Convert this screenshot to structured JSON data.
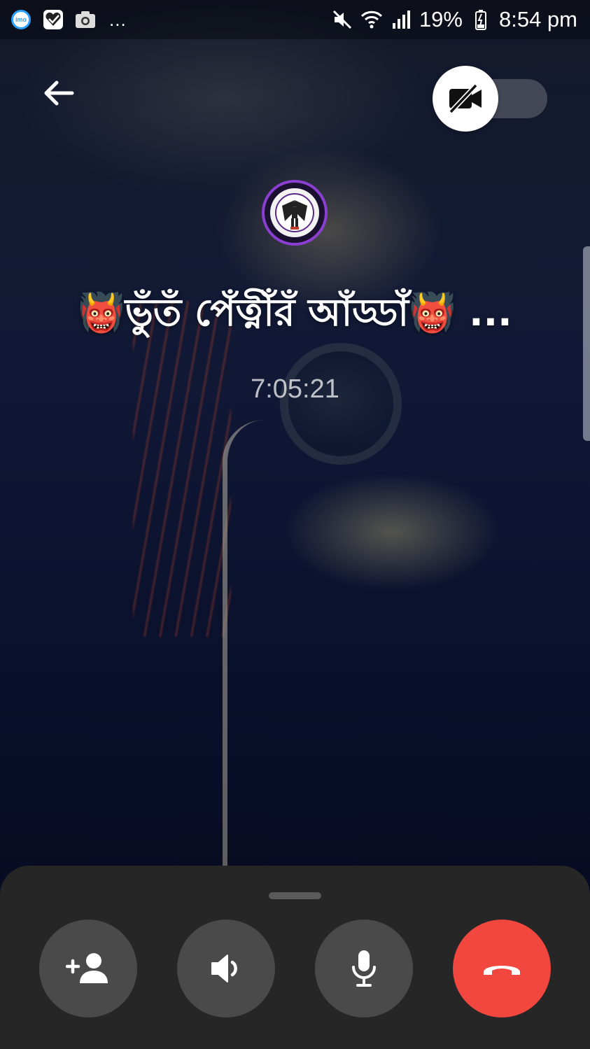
{
  "status_bar": {
    "battery": "19%",
    "time": "8:54 pm",
    "more": "..."
  },
  "call": {
    "title": "👹ভুঁতঁ পেঁত্নীঁরঁ আঁড্ডাঁ👹 ...",
    "duration": "7:05:21"
  },
  "icons": {
    "back": "arrow-left-icon",
    "video": "video-off-icon",
    "add_person": "add-person-icon",
    "speaker": "speaker-icon",
    "mic": "microphone-icon",
    "end_call": "hang-up-icon"
  },
  "colors": {
    "end_call": "#f2473f",
    "control_bg": "#4a4a4a",
    "panel_bg": "#262626",
    "avatar_ring": "#8a3fd0"
  },
  "video_toggle": {
    "enabled": false
  }
}
